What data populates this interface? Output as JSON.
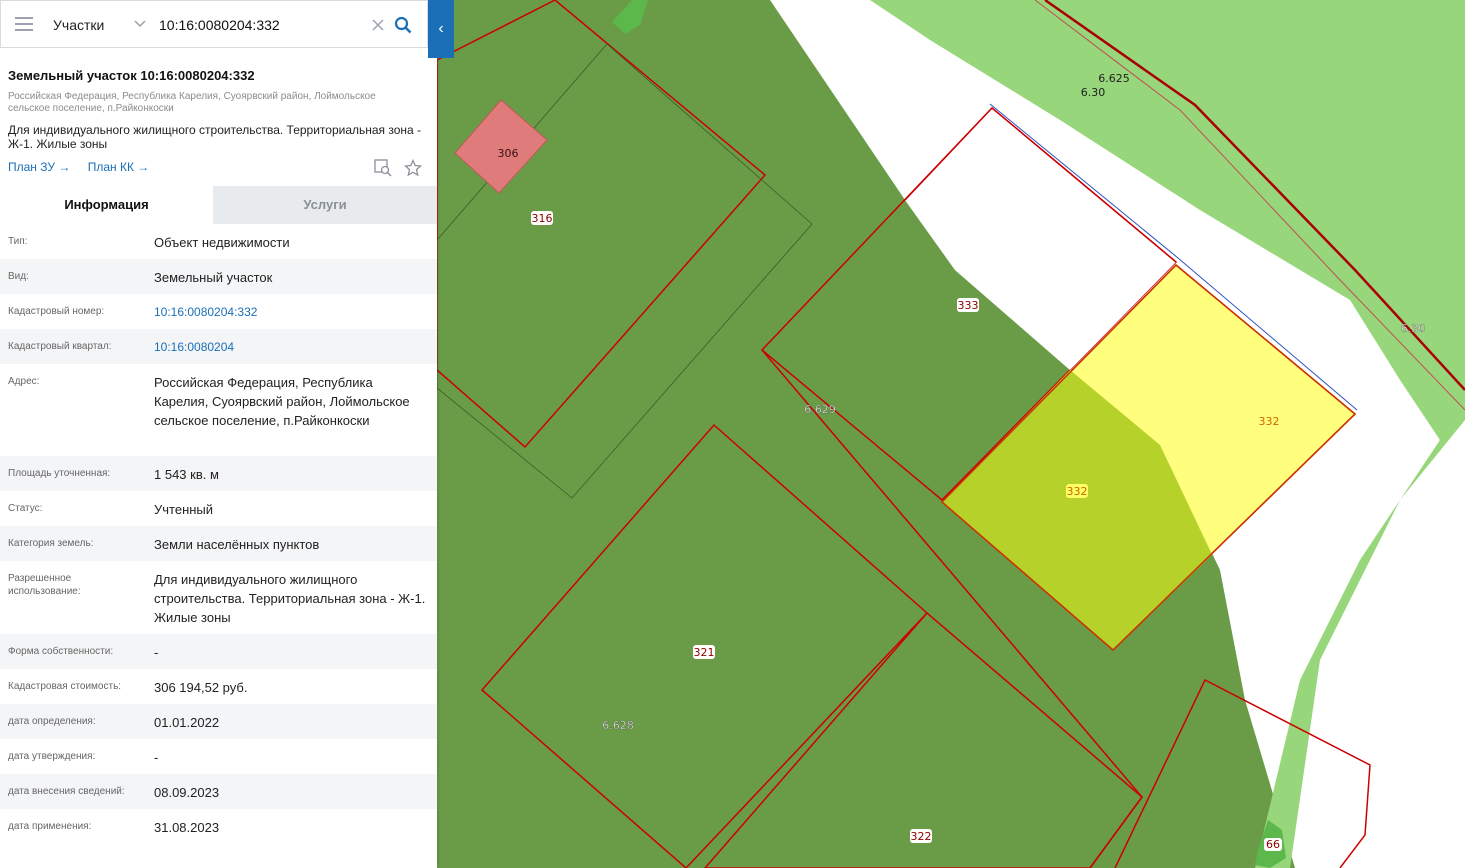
{
  "search": {
    "layer": "Участки",
    "query": "10:16:0080204:332"
  },
  "parcel": {
    "title": "Земельный участок 10:16:0080204:332",
    "address_short": "Российская Федерация, Республика Карелия, Суоярвский район, Лоймольское сельское поселение, п.Райконкоски",
    "permitted_use": "Для индивидуального жилищного строительства. Территориальная зона - Ж-1. Жилые зоны",
    "links": [
      "План ЗУ →",
      "План КК →"
    ]
  },
  "tabs": [
    "Информация",
    "Услуги"
  ],
  "info_rows": [
    {
      "key": "Тип:",
      "value": "Объект недвижимости"
    },
    {
      "key": "Вид:",
      "value": "Земельный участок"
    },
    {
      "key": "Кадастровый номер:",
      "value": "10:16:0080204:332"
    },
    {
      "key": "Кадастровый квартал:",
      "value": "10:16:0080204"
    },
    {
      "key": "Адрес:",
      "value": "Российская Федерация, Республика Карелия, Суоярвский район, Лоймольское сельское поселение, п.Райконкоски"
    },
    {
      "key": "Площадь уточненная:",
      "value": "1 543 кв. м"
    },
    {
      "key": "Статус:",
      "value": "Учтенный"
    },
    {
      "key": "Категория земель:",
      "value": "Земли населённых пунктов"
    },
    {
      "key": "Разрешенное использование:",
      "value": "Для индивидуального жилищного строительства. Территориальная зона - Ж-1. Жилые зоны"
    },
    {
      "key": "Форма собственности:",
      "value": "-"
    },
    {
      "key": "Кадастровая стоимость:",
      "value": "306 194,52 руб."
    },
    {
      "key": "дата определения:",
      "value": "01.01.2022"
    },
    {
      "key": "дата утверждения:",
      "value": "-"
    },
    {
      "key": "дата внесения сведений:",
      "value": "08.09.2023"
    },
    {
      "key": "дата применения:",
      "value": "31.08.2023"
    }
  ],
  "map": {
    "labels": [
      "306",
      "316",
      "333",
      "332",
      "332",
      "6.629",
      "321",
      "6.628",
      "322",
      "6.625",
      "6.30",
      "6.30",
      "66"
    ],
    "colors": {
      "zone_dark_green": "#6a9c47",
      "zone_light_green": "#97d67a",
      "selected_parcel": "#ffff66",
      "parcel_border": "#cc0000",
      "small_parcel": "#e07b7b"
    }
  }
}
